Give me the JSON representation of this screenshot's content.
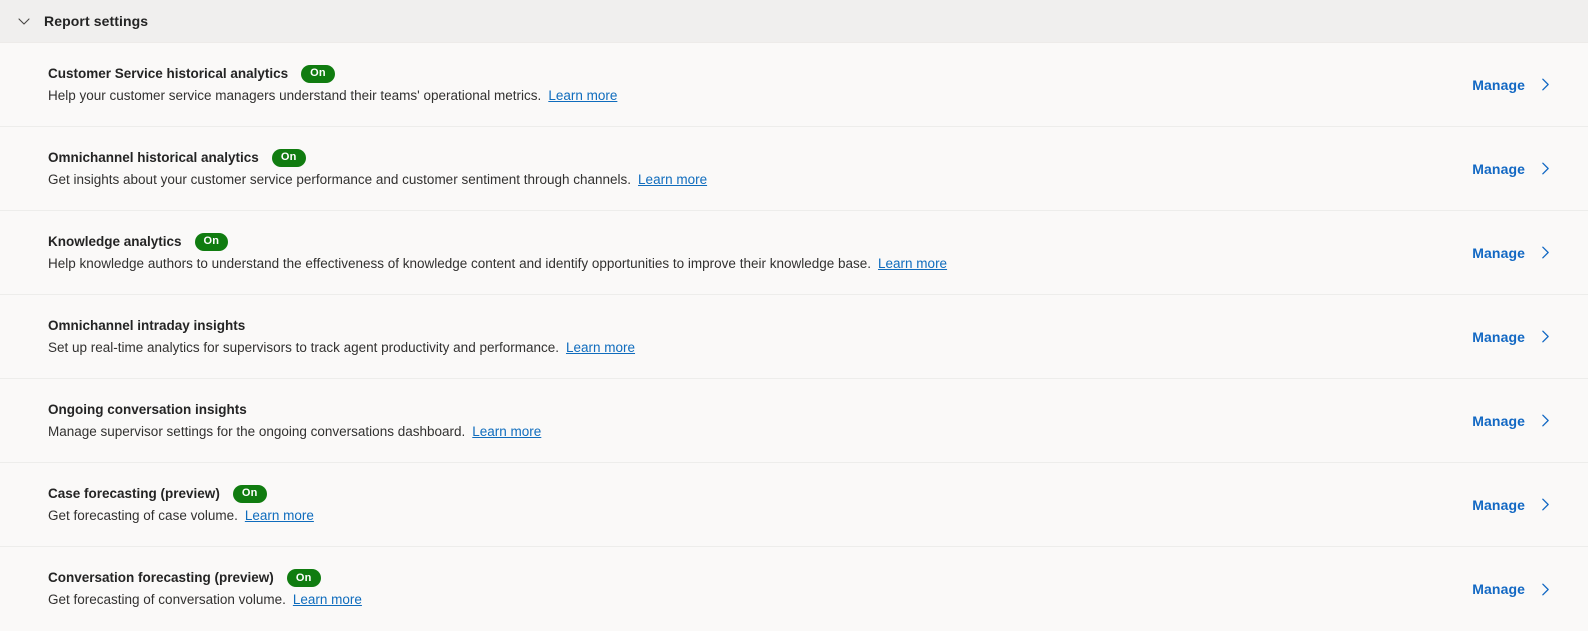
{
  "header": {
    "title": "Report settings",
    "collapse_icon": "chevron-down-icon"
  },
  "common": {
    "manage_label": "Manage",
    "manage_icon": "chevron-right-icon",
    "learn_more_label": "Learn more",
    "badge_on_label": "On",
    "accent_link_color": "#1268c3",
    "badge_on_color": "#107c10",
    "inline_link_color": "#0f6cbd",
    "header_background": "#f0efee",
    "content_background": "#faf9f8"
  },
  "rows": [
    {
      "title": "Customer Service historical analytics",
      "badge": "On",
      "description": "Help your customer service managers understand their teams' operational metrics.",
      "learn_more": "Learn more",
      "manage": "Manage"
    },
    {
      "title": "Omnichannel historical analytics",
      "badge": "On",
      "description": "Get insights about your customer service performance and customer sentiment through channels.",
      "learn_more": "Learn more",
      "manage": "Manage"
    },
    {
      "title": "Knowledge analytics",
      "badge": "On",
      "description": "Help knowledge authors to understand the effectiveness of knowledge content and identify opportunities to improve their knowledge base.",
      "learn_more": "Learn more",
      "manage": "Manage"
    },
    {
      "title": "Omnichannel intraday insights",
      "badge": null,
      "description": "Set up real-time analytics for supervisors to track agent productivity and performance.",
      "learn_more": "Learn more",
      "manage": "Manage"
    },
    {
      "title": "Ongoing conversation insights",
      "badge": null,
      "description": "Manage supervisor settings for the ongoing conversations dashboard.",
      "learn_more": "Learn more",
      "manage": "Manage"
    },
    {
      "title": "Case forecasting (preview)",
      "badge": "On",
      "description": "Get forecasting of case volume.",
      "learn_more": "Learn more",
      "manage": "Manage"
    },
    {
      "title": "Conversation forecasting (preview)",
      "badge": "On",
      "description": "Get forecasting of conversation volume.",
      "learn_more": "Learn more",
      "manage": "Manage"
    }
  ]
}
